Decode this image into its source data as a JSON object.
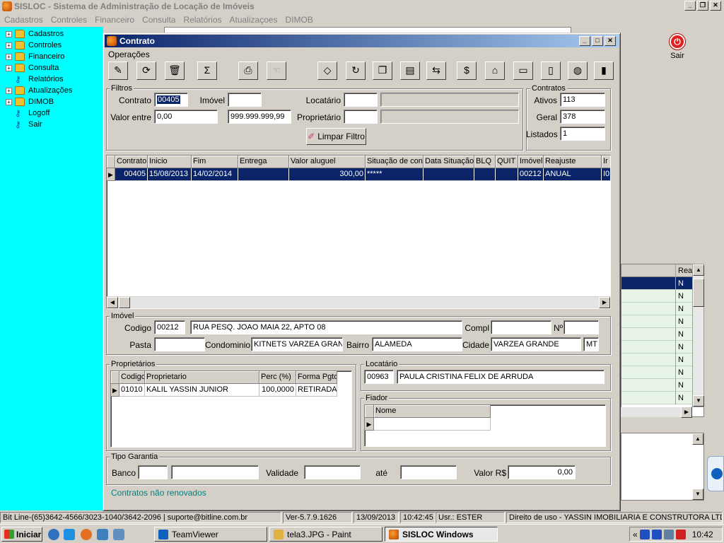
{
  "app": {
    "title": "SISLOC - Sistema de Administração de Locação de Imóveis"
  },
  "menu": [
    "Cadastros",
    "Controles",
    "Financeiro",
    "Consulta",
    "Relatórios",
    "Atualizaçoes",
    "DIMOB"
  ],
  "tree": [
    {
      "label": "Cadastros",
      "icon": "folder-icon",
      "exp": true
    },
    {
      "label": "Controles",
      "icon": "folder-icon",
      "exp": true
    },
    {
      "label": "Financeiro",
      "icon": "folder-icon",
      "exp": true
    },
    {
      "label": "Consulta",
      "icon": "folder-icon",
      "exp": true
    },
    {
      "label": "Relatórios",
      "icon": "key-icon",
      "exp": false
    },
    {
      "label": "Atualizações",
      "icon": "folder-icon",
      "exp": true
    },
    {
      "label": "DIMOB",
      "icon": "folder-icon",
      "exp": true
    },
    {
      "label": "Logoff",
      "icon": "key-icon",
      "exp": false
    },
    {
      "label": "Sair",
      "icon": "key-icon",
      "exp": false
    }
  ],
  "sair_label": "Sair",
  "bg_grid": {
    "header": "Real",
    "rows": [
      "N",
      "N",
      "N",
      "N",
      "N",
      "N",
      "N",
      "N",
      "N",
      "N"
    ]
  },
  "dialog": {
    "title": "Contrato",
    "operations_menu": "Operações",
    "toolbar": [
      {
        "name": "eraser-icon",
        "glyph": "✎"
      },
      {
        "name": "refresh-doc-icon",
        "glyph": "⟳"
      },
      {
        "name": "trash-icon",
        "glyph": "🗑"
      },
      {
        "name": "sum-icon",
        "glyph": "Σ"
      },
      {
        "name": "print-icon",
        "glyph": "⎙"
      },
      {
        "name": "hand-icon",
        "glyph": "☜"
      },
      {
        "name": "tag-icon",
        "glyph": "◇"
      },
      {
        "name": "red-cycle-icon",
        "glyph": "↻"
      },
      {
        "name": "copy-icon",
        "glyph": "❐"
      },
      {
        "name": "stack-icon",
        "glyph": "▤"
      },
      {
        "name": "transfer-icon",
        "glyph": "⇆"
      },
      {
        "name": "sp-icon",
        "glyph": "$"
      },
      {
        "name": "house-icon",
        "glyph": "⌂"
      },
      {
        "name": "card-icon",
        "glyph": "▭"
      },
      {
        "name": "document-icon",
        "glyph": "▯"
      },
      {
        "name": "globe-icon",
        "glyph": "◍"
      },
      {
        "name": "exit-door-icon",
        "glyph": "▮"
      }
    ],
    "filtros": {
      "legend": "Filtros",
      "contrato_label": "Contrato",
      "contrato_value": "00405",
      "imovel_label": "Imóvel",
      "imovel_value": "",
      "locatario_label": "Locatário",
      "locatario_value": "",
      "locatario_name": "",
      "valor_label": "Valor entre",
      "valor_min": "0,00",
      "valor_max": "999.999.999,99",
      "proprietario_label": "Proprietário",
      "proprietario_value": "",
      "proprietario_name": "",
      "limpar_label": "Limpar Filtro"
    },
    "contratos": {
      "legend": "Contratos",
      "ativos_label": "Ativos",
      "ativos_value": "113",
      "geral_label": "Geral",
      "geral_value": "378",
      "listados_label": "Listados",
      "listados_value": "1"
    },
    "grid": {
      "columns": [
        "Contrato",
        "Inicio",
        "Fim",
        "Entrega",
        "Valor aluguel",
        "Situação de con",
        "Data Situação",
        "BLQ",
        "QUIT",
        "Imóvel",
        "Reajuste",
        "Ir"
      ],
      "rows": [
        [
          "00405",
          "15/08/2013",
          "14/02/2014",
          "",
          "300,00",
          "*****",
          "",
          "",
          "",
          "00212",
          "ANUAL",
          "I0"
        ]
      ]
    },
    "imovel": {
      "legend": "Imóvel",
      "codigo_label": "Codigo",
      "codigo_value": "00212",
      "endereco": "RUA PESQ. JOAO MAIA 22, APTO 08",
      "compl_label": "Compl",
      "compl_value": "",
      "num_label": "Nº",
      "num_value": "",
      "pasta_label": "Pasta",
      "pasta_value": "",
      "condominio_label": "Condominio",
      "condominio_value": "KITNETS VARZEA GRAN",
      "bairro_label": "Bairro",
      "bairro_value": "ALAMEDA",
      "cidade_label": "Cidade",
      "cidade_value": "VARZEA GRANDE",
      "uf_value": "MT"
    },
    "proprietarios": {
      "legend": "Proprietários",
      "columns": [
        "Codigo",
        "Proprietario",
        "Perc (%)",
        "Forma Pgto"
      ],
      "rows": [
        [
          "01010",
          "KALIL YASSIN JUNIOR",
          "100,0000",
          "RETIRADA"
        ]
      ]
    },
    "locatario": {
      "legend": "Locatário",
      "codigo": "00963",
      "nome": "PAULA CRISTINA FELIX DE ARRUDA"
    },
    "fiador": {
      "legend": "Fiador",
      "column": "Nome"
    },
    "garantia": {
      "legend": "Tipo Garantia",
      "banco_label": "Banco",
      "validade_label": "Validade",
      "ate_label": "até",
      "valor_label": "Valor R$",
      "valor_value": "0,00"
    },
    "status_message": "Contratos não renovados"
  },
  "statusbar": [
    "Bit Line-(65)3642-4566/3023-1040/3642-2096 | suporte@bitline.com.br",
    "Ver-5.7.9.1626",
    "13/09/2013",
    "10:42:45",
    "Usr.: ESTER",
    "Direito de uso - YASSIN IMOBILIARIA E CONSTRUTORA LTDA"
  ],
  "taskbar": {
    "start": "Iniciar",
    "tasks": [
      "TeamViewer",
      "tela3.JPG - Paint",
      "SISLOC Windows"
    ],
    "clock": "10:42",
    "tray_chevron": "«"
  },
  "colors": {
    "tree_bg": "#00ffff",
    "selection": "#0a246a",
    "title_gradient_start": "#0a246a",
    "status_message": "#008080"
  }
}
